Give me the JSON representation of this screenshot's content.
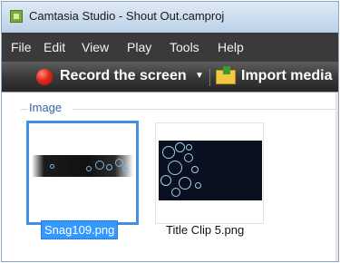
{
  "window": {
    "title": "Camtasia Studio - Shout Out.camproj",
    "app_icon": "camtasia-icon"
  },
  "menu": {
    "items": [
      "File",
      "Edit",
      "View",
      "Play",
      "Tools",
      "Help"
    ]
  },
  "toolbar": {
    "record_label": "Record the screen",
    "record_icon": "record-icon",
    "record_dropdown": "▼",
    "import_label": "Import media",
    "import_icon": "folder-import-icon"
  },
  "bin": {
    "group_label": "Image",
    "clips": [
      {
        "name": "Snag109.png",
        "selected": true
      },
      {
        "name": "Title Clip 5.png",
        "selected": false
      }
    ]
  },
  "colors": {
    "selection": "#3399ff",
    "selection_border": "#3f8fe6",
    "menubar": "#3a3a3a",
    "group_label": "#3764a8",
    "record_red": "#e02a1a"
  }
}
